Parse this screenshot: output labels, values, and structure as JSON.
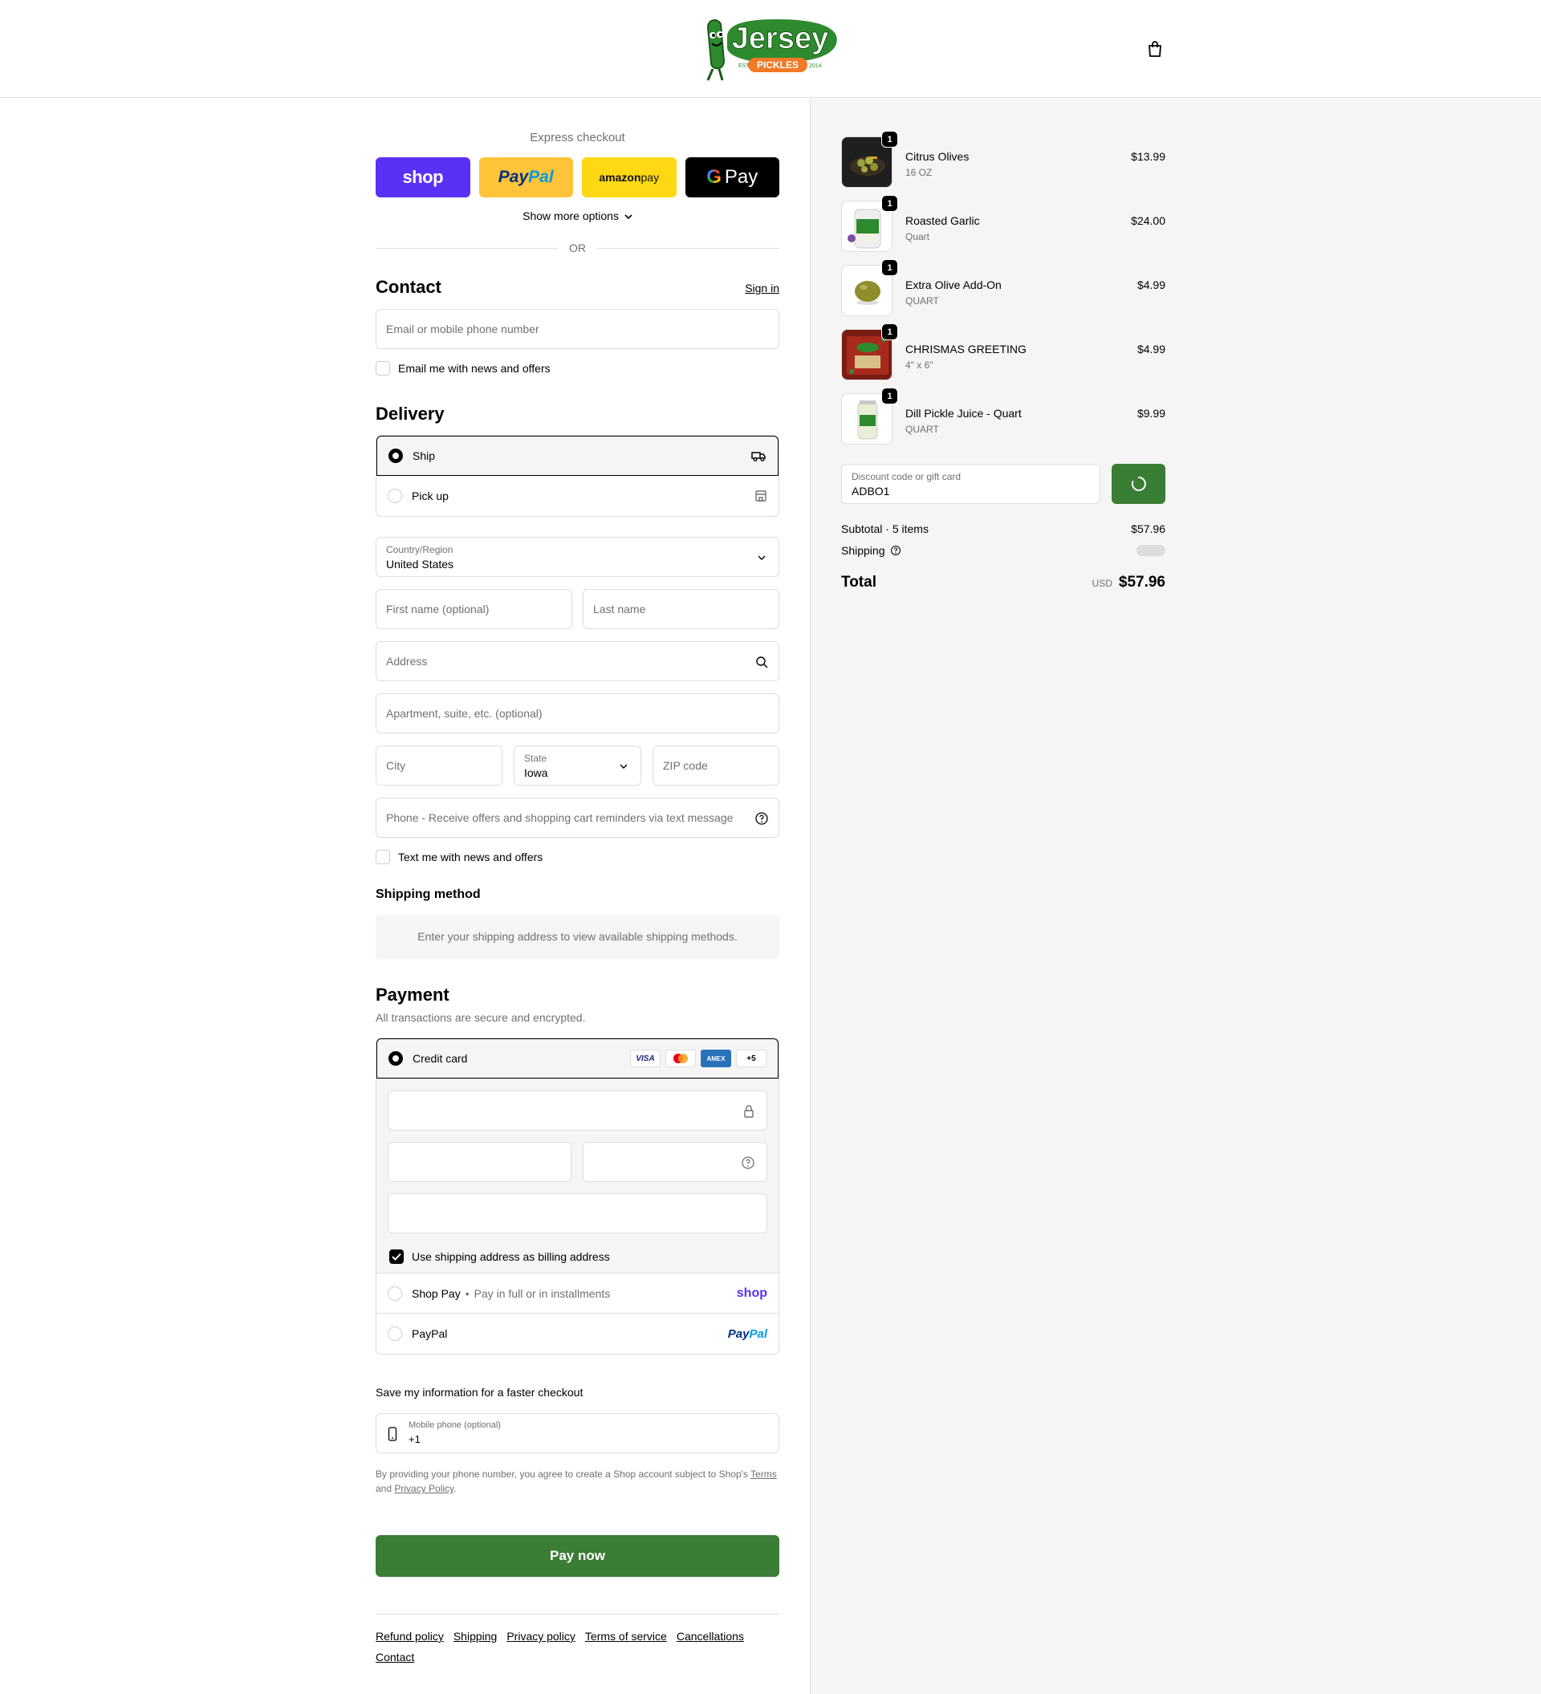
{
  "header": {
    "logo_text": "Jersey",
    "logo_sub": "PICKLES",
    "logo_est": "EST",
    "logo_year": "2014"
  },
  "express": {
    "title": "Express checkout",
    "shop_label": "shop",
    "paypal_label_a": "Pay",
    "paypal_label_b": "Pal",
    "amazon_label_a": "amazon",
    "amazon_label_b": " pay",
    "gpay_label": "Pay",
    "more_options": "Show more options",
    "or": "OR"
  },
  "contact": {
    "title": "Contact",
    "sign_in": "Sign in",
    "email_placeholder": "Email or mobile phone number",
    "news_label": "Email me with news and offers"
  },
  "delivery": {
    "title": "Delivery",
    "options": [
      {
        "label": "Ship",
        "selected": true
      },
      {
        "label": "Pick up",
        "selected": false
      }
    ],
    "country_label": "Country/Region",
    "country_value": "United States",
    "first_name_placeholder": "First name (optional)",
    "last_name_placeholder": "Last name",
    "address_placeholder": "Address",
    "apartment_placeholder": "Apartment, suite, etc. (optional)",
    "city_placeholder": "City",
    "state_label": "State",
    "state_value": "Iowa",
    "zip_placeholder": "ZIP code",
    "phone_placeholder": "Phone - Receive offers and shopping cart reminders via text message",
    "text_news_label": "Text me with news and offers"
  },
  "shipping_method": {
    "title": "Shipping method",
    "notice": "Enter your shipping address to view available shipping methods."
  },
  "payment": {
    "title": "Payment",
    "subtitle": "All transactions are secure and encrypted.",
    "credit_card_label": "Credit card",
    "card_badges": [
      "VISA",
      "AMEX",
      "+5"
    ],
    "billing_label": "Use shipping address as billing address",
    "shop_pay_label": "Shop Pay",
    "shop_pay_sep": "•",
    "shop_pay_desc": "Pay in full or in installments",
    "shop_pay_logo": "shop",
    "paypal_label": "PayPal",
    "paypal_logo_a": "Pay",
    "paypal_logo_b": "Pal"
  },
  "save_info": {
    "title": "Save my information for a faster checkout",
    "mobile_label": "Mobile phone (optional)",
    "mobile_value": "+1",
    "terms_a": "By providing your phone number, you agree to create a Shop account subject to Shop's ",
    "terms_link": "Terms",
    "terms_b": "and ",
    "privacy_link": "Privacy Policy",
    "terms_c": "."
  },
  "pay_now": "Pay now",
  "footer": {
    "links": [
      "Refund policy",
      "Shipping",
      "Privacy policy",
      "Terms of service",
      "Cancellations",
      "Contact"
    ]
  },
  "summary": {
    "items": [
      {
        "name": "Citrus Olives",
        "variant": "16 OZ",
        "price": "$13.99",
        "qty": "1"
      },
      {
        "name": "Roasted Garlic",
        "variant": "Quart",
        "price": "$24.00",
        "qty": "1"
      },
      {
        "name": "Extra Olive Add-On",
        "variant": "QUART",
        "price": "$4.99",
        "qty": "1"
      },
      {
        "name": "CHRISMAS GREETING",
        "variant": "4\" x 6\"",
        "price": "$4.99",
        "qty": "1"
      },
      {
        "name": "Dill Pickle Juice - Quart",
        "variant": "QUART",
        "price": "$9.99",
        "qty": "1"
      }
    ],
    "discount_label": "Discount code or gift card",
    "discount_value": "ADBO1",
    "subtotal_label": "Subtotal · 5 items",
    "subtotal_value": "$57.96",
    "shipping_label": "Shipping",
    "total_label": "Total",
    "currency": "USD",
    "total_value": "$57.96"
  },
  "colors": {
    "accent_green": "#3a7d34",
    "shop_purple": "#5a31f4",
    "paypal_yellow": "#ffc439",
    "amazon_yellow": "#ffd814"
  }
}
